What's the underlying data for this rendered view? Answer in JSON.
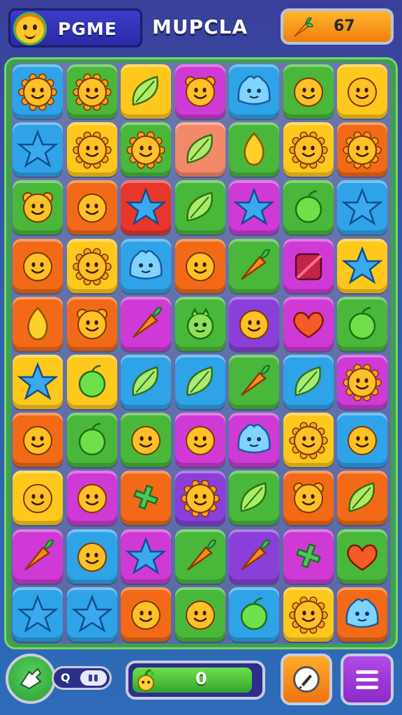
{
  "header": {
    "logo_text": "PGME",
    "title": "MUPCLA",
    "score": "67"
  },
  "footer": {
    "toggle_label": "Q",
    "progress_value": "0",
    "progress_fraction": 0.95
  },
  "colors": {
    "O": "#f26a17",
    "Y": "#ffc81d",
    "G": "#49b83a",
    "B": "#2fa3e8",
    "P": "#cf3ad6",
    "R": "#e8372a",
    "V": "#8a3fd8",
    "PE": "#f28a6a"
  },
  "board": [
    [
      {
        "c": "B",
        "i": "sun"
      },
      {
        "c": "G",
        "i": "sun"
      },
      {
        "c": "Y",
        "i": "leaf"
      },
      {
        "c": "P",
        "i": "bear"
      },
      {
        "c": "B",
        "i": "blob"
      },
      {
        "c": "G",
        "i": "face"
      },
      {
        "c": "Y",
        "i": "face"
      }
    ],
    [
      {
        "c": "B",
        "i": "star"
      },
      {
        "c": "Y",
        "i": "sun"
      },
      {
        "c": "G",
        "i": "sun"
      },
      {
        "c": "PE",
        "i": "leaf"
      },
      {
        "c": "G",
        "i": "drop"
      },
      {
        "c": "Y",
        "i": "sun"
      },
      {
        "c": "O",
        "i": "sun"
      }
    ],
    [
      {
        "c": "G",
        "i": "bear"
      },
      {
        "c": "O",
        "i": "face"
      },
      {
        "c": "R",
        "i": "star"
      },
      {
        "c": "G",
        "i": "leaf"
      },
      {
        "c": "P",
        "i": "star"
      },
      {
        "c": "G",
        "i": "lime"
      },
      {
        "c": "B",
        "i": "star"
      }
    ],
    [
      {
        "c": "O",
        "i": "face"
      },
      {
        "c": "Y",
        "i": "sun"
      },
      {
        "c": "B",
        "i": "blob"
      },
      {
        "c": "O",
        "i": "face"
      },
      {
        "c": "G",
        "i": "carrot"
      },
      {
        "c": "P",
        "i": "square"
      },
      {
        "c": "Y",
        "i": "star"
      }
    ],
    [
      {
        "c": "O",
        "i": "drop"
      },
      {
        "c": "O",
        "i": "bear"
      },
      {
        "c": "P",
        "i": "carrot"
      },
      {
        "c": "G",
        "i": "monster"
      },
      {
        "c": "V",
        "i": "face"
      },
      {
        "c": "P",
        "i": "heart"
      },
      {
        "c": "G",
        "i": "lime"
      }
    ],
    [
      {
        "c": "Y",
        "i": "star"
      },
      {
        "c": "Y",
        "i": "lime"
      },
      {
        "c": "B",
        "i": "leaf"
      },
      {
        "c": "B",
        "i": "leaf"
      },
      {
        "c": "G",
        "i": "carrot"
      },
      {
        "c": "B",
        "i": "leaf"
      },
      {
        "c": "P",
        "i": "sun"
      }
    ],
    [
      {
        "c": "O",
        "i": "face"
      },
      {
        "c": "G",
        "i": "lime"
      },
      {
        "c": "G",
        "i": "face"
      },
      {
        "c": "P",
        "i": "face"
      },
      {
        "c": "P",
        "i": "blob"
      },
      {
        "c": "Y",
        "i": "sun"
      },
      {
        "c": "B",
        "i": "face"
      }
    ],
    [
      {
        "c": "Y",
        "i": "face"
      },
      {
        "c": "P",
        "i": "face"
      },
      {
        "c": "O",
        "i": "plus"
      },
      {
        "c": "V",
        "i": "sun"
      },
      {
        "c": "G",
        "i": "leaf"
      },
      {
        "c": "O",
        "i": "bear"
      },
      {
        "c": "O",
        "i": "leaf"
      }
    ],
    [
      {
        "c": "P",
        "i": "carrot"
      },
      {
        "c": "B",
        "i": "face"
      },
      {
        "c": "P",
        "i": "star"
      },
      {
        "c": "G",
        "i": "carrot"
      },
      {
        "c": "V",
        "i": "carrot"
      },
      {
        "c": "P",
        "i": "plus"
      },
      {
        "c": "G",
        "i": "heart"
      }
    ],
    [
      {
        "c": "B",
        "i": "star"
      },
      {
        "c": "B",
        "i": "star"
      },
      {
        "c": "O",
        "i": "face"
      },
      {
        "c": "G",
        "i": "face"
      },
      {
        "c": "B",
        "i": "lime"
      },
      {
        "c": "Y",
        "i": "sun"
      },
      {
        "c": "O",
        "i": "blob"
      }
    ]
  ]
}
